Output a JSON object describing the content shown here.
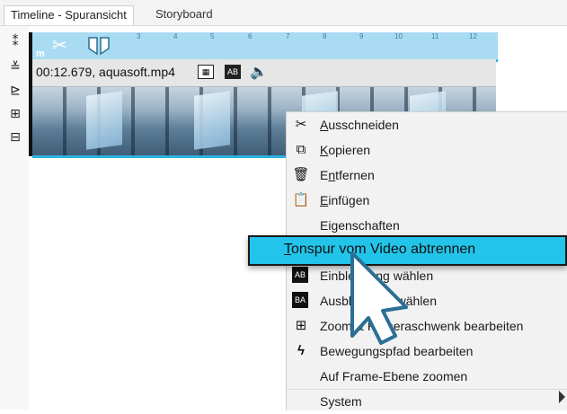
{
  "tabs": [
    {
      "label": "Timeline - Spuransicht"
    },
    {
      "label": "Storyboard"
    }
  ],
  "ruler": {
    "ticks": [
      "3",
      "4",
      "5",
      "6",
      "7",
      "8",
      "9",
      "10",
      "11",
      "12"
    ],
    "label": "m"
  },
  "clip": {
    "info": "00:12.679,  aquasoft.mp4"
  },
  "menu": {
    "items": [
      {
        "label_u": "A",
        "label_rest": "usschneiden",
        "icon": "scissors-icon"
      },
      {
        "label_u": "K",
        "label_rest": "opieren",
        "icon": "copy-icon"
      },
      {
        "label_pre": "E",
        "label_u": "n",
        "label_rest": "tfernen",
        "icon": "trash-icon"
      },
      {
        "label_u": "E",
        "label_rest": "infügen",
        "icon": "paste-icon"
      },
      {
        "label": "Eigenschaften"
      },
      {
        "label_u": "T",
        "label_rest": "onspur vom Video abtrennen"
      },
      {
        "label": "Einblendung wählen",
        "icon": "fade-in-icon"
      },
      {
        "label": "Ausblendung wählen",
        "icon": "fade-out-icon"
      },
      {
        "label": "Zoom & Kameraschwenk bearbeiten",
        "icon": "zoom-pan-icon"
      },
      {
        "label": "Bewegungspfad bearbeiten",
        "icon": "motion-path-icon"
      },
      {
        "label": "Auf Frame-Ebene zoomen"
      },
      {
        "label": "System"
      }
    ]
  },
  "colors": {
    "highlight": "#22c4ea",
    "ruler": "#a9dcf2",
    "accent": "#2bb2e6"
  }
}
